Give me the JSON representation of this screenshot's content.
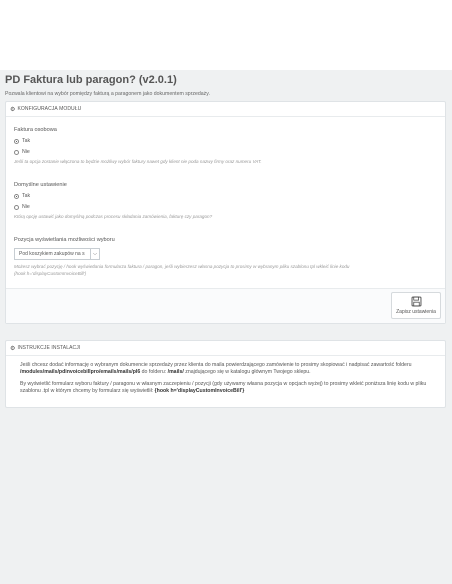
{
  "page": {
    "title": "PD Faktura lub paragon? (v2.0.1)",
    "description": "Pozwala klientowi na wybór pomiędzy fakturą a paragonem jako dokumentem sprzedaży."
  },
  "config_panel": {
    "heading": "KONFIGURACJA MODUŁU",
    "heading_icon": "gears-icon",
    "invoice_field": {
      "label": "Faktura osobowa",
      "options": [
        "Tak",
        "Nie"
      ],
      "selected": "Tak",
      "help": "Jeśli ta opcja zostanie włączona to będzie możliwy wybór faktury nawet gdy klient nie poda nazwy firmy oraz numeru VAT."
    },
    "default_field": {
      "label": "Domyślne ustawienie",
      "options": [
        "Tak",
        "Nie"
      ],
      "selected": "Tak",
      "help": "Którą opcję ustawić jako domyślną podczas procesu składania zamówienia, fakturę czy paragon?"
    },
    "position_field": {
      "label": "Pozycja wyświetlania możliwości wyboru",
      "selected_value": "Pod koszykiem zakupów na s",
      "help_line1": "Możesz wybrać pozycję / hook wyświetlania formularza faktura / paragon, jeśli wybierzesz własna pozycja to prosimy w wybranym pliku szablonu tpl wkleić linie kodu",
      "help_line2": "{hook h='displayCustomInvoiceBill'}"
    },
    "save_button": {
      "label": "Zapisz ustawienia",
      "icon": "floppy-disk-icon"
    }
  },
  "instructions_panel": {
    "heading": "INSTRUKCJE INSTALACJI",
    "heading_icon": "gears-icon",
    "p1_a": "Jeśli chcesz dodać informację o wybranym dokumencie sprzedaży przez klienta do maila powierdzającego zamówienie to prosimy skopiować i nadpisać zawartość folderu ",
    "p1_b": "/modules/mails/pdinvoicebillpro/emails/mails/pl6",
    "p1_c": " do folderu: ",
    "p1_d": "/mails/",
    "p1_e": " znajdującego się w katalogu głównym Twojego sklepu.",
    "p2_a": "By wyświetlić formularz wyboru faktury / paragonu w własnym zaczepieniu / pozycji (gdy używamy własna pozycja w opcjach wyżej) to prosimy wkleić poniższa linię kodu w pliku szablonu .tpl w którym chcemy by formularz się wyświetlił: ",
    "p2_b": "{hook h='displayCustomInvoiceBill'}"
  }
}
